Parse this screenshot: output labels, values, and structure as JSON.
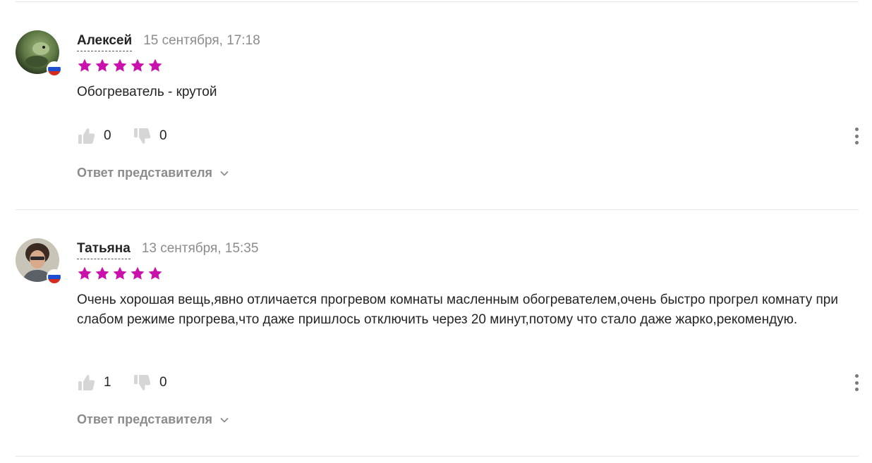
{
  "colors": {
    "star": "#cb11ab",
    "muted": "#8c8c8c",
    "icon": "#d6d6d6",
    "divider": "#e6e6e6"
  },
  "reviews": [
    {
      "author": "Алексей",
      "date": "15 сентября, 17:18",
      "rating": 5,
      "text": "Обогреватель - крутой",
      "likes": "0",
      "dislikes": "0",
      "reply_label": "Ответ представителя",
      "flag": "russia-flag-icon"
    },
    {
      "author": "Татьяна",
      "date": "13 сентября, 15:35",
      "rating": 5,
      "text": "Очень хорошая вещь,явно отличается прогревом комнаты масленным обогревателем,очень быстро прогрел комнату при слабом режиме прогрева,что даже пришлось отключить через 20 минут,потому что стало даже жарко,рекомендую.",
      "likes": "1",
      "dislikes": "0",
      "reply_label": "Ответ представителя",
      "flag": "russia-flag-icon"
    }
  ]
}
